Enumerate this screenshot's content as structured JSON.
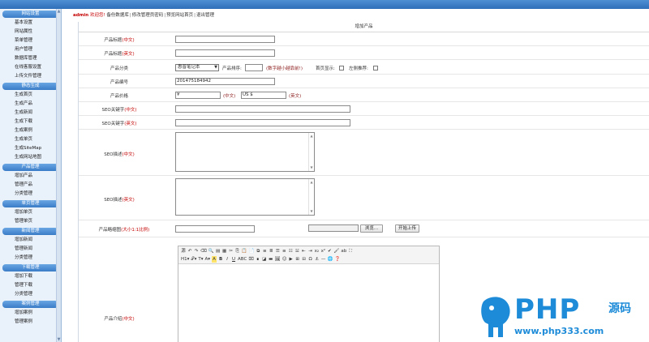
{
  "colors": {
    "topbar": "#3a7cc6",
    "sidebar_bg": "#e9f1fa",
    "accent_red": "#c40000",
    "watermark": "#1d8bd8"
  },
  "sidebar": {
    "groups": [
      {
        "title": "网站设置",
        "items": [
          "基本设置",
          "网站属性",
          "菜单管理",
          "用户管理",
          "数据库管理",
          "在线客服设置",
          "上传文件管理"
        ]
      },
      {
        "title": "静态生成",
        "items": [
          "生成首页",
          "生成产品",
          "生成新闻",
          "生成下载",
          "生成案例",
          "生成单页",
          "生成SiteMap",
          "生成网站地图"
        ]
      },
      {
        "title": "产品管理",
        "items": [
          "增加产品",
          "管理产品",
          "分类管理"
        ]
      },
      {
        "title": "单页管理",
        "items": [
          "增加单页",
          "管理单页"
        ]
      },
      {
        "title": "新闻管理",
        "items": [
          "增加新闻",
          "管理新闻",
          "分类管理"
        ]
      },
      {
        "title": "下载管理",
        "items": [
          "增加下载",
          "管理下载",
          "分类管理"
        ]
      },
      {
        "title": "案例管理",
        "items": [
          "增加案例",
          "管理案例"
        ]
      }
    ]
  },
  "topnav": {
    "admin": "admin",
    "welcome": "欢迎您!",
    "links": [
      "备份数据库",
      "修改管理员密码",
      "预览网站首页",
      "退出管理"
    ]
  },
  "page_title": "增加产品",
  "form": {
    "name_cn": {
      "label": "产品标题",
      "tag": "(中文)",
      "value": ""
    },
    "name_en": {
      "label": "产品标题",
      "tag": "(英文)",
      "value": ""
    },
    "category": {
      "label": "产品分类",
      "selected": "惠普笔记本",
      "sort_label": "产品排序:",
      "sort_value": "",
      "sort_note": "(数字越小越靠前!)",
      "home_label": "首页显示:",
      "left_label": "左侧推荐:"
    },
    "code": {
      "label": "产品编号",
      "value": "201475184942"
    },
    "price": {
      "label": "产品价格",
      "cn_value": "¥",
      "cn_tag": "(中文)",
      "en_value": "US $",
      "en_tag": "(英文)"
    },
    "seo_kw_cn": {
      "label": "SEO关键字",
      "tag": "(中文)"
    },
    "seo_kw_en": {
      "label": "SEO关键字",
      "tag": "(英文)"
    },
    "seo_desc_cn": {
      "label": "SEO描述",
      "tag": "(中文)"
    },
    "seo_desc_en": {
      "label": "SEO描述",
      "tag": "(英文)"
    },
    "thumb": {
      "label": "产品略缩图",
      "tag": "(大小1:1比例)",
      "browse": "浏览...",
      "upload": "开始上传"
    },
    "intro": {
      "label": "产品介绍",
      "tag": "(中文)"
    }
  },
  "editor": {
    "toolbar_row1": [
      "源",
      "↶",
      "↷",
      "⌫",
      "🔍",
      "▤",
      "▦",
      "✂",
      "⎘",
      "📋",
      "📄",
      "⧉",
      "≡",
      "≣",
      "☰",
      "≡",
      "☷",
      "☱",
      "⇤",
      "⇥",
      "x₂",
      "x²",
      "✔",
      "🖌",
      "ab",
      "⛶"
    ],
    "toolbar_row2": [
      "H1▾",
      "𝒯▾",
      "T▾",
      "A▾",
      "A",
      "B",
      "I",
      "U",
      "ABC",
      "⌧",
      "∎",
      "◪",
      "▬",
      "🖼",
      "☺",
      "▶",
      "⊞",
      "⊟",
      "Ω",
      "⚓",
      "—",
      "🌐",
      "❓"
    ]
  },
  "watermark": {
    "brand": "PHP",
    "suffix": "源码",
    "url": "www.php333.com"
  }
}
